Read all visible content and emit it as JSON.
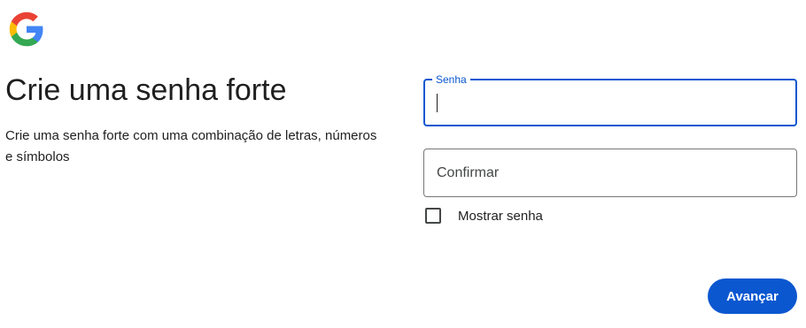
{
  "logo": {
    "icon": "google-g-icon",
    "colors": {
      "blue": "#4285f4",
      "red": "#ea4335",
      "yellow": "#fbbc05",
      "green": "#34a853"
    }
  },
  "header": {
    "title": "Crie uma senha forte",
    "subtitle": "Crie uma senha forte com uma combinação de letras, números e símbolos"
  },
  "form": {
    "password": {
      "label": "Senha",
      "value": ""
    },
    "confirm": {
      "placeholder": "Confirmar",
      "value": ""
    },
    "show_password": {
      "label": "Mostrar senha",
      "checked": false
    }
  },
  "actions": {
    "next_label": "Avançar"
  },
  "theme": {
    "accent": "#0b57d0",
    "text": "#1f1f1f",
    "border": "#747775"
  }
}
